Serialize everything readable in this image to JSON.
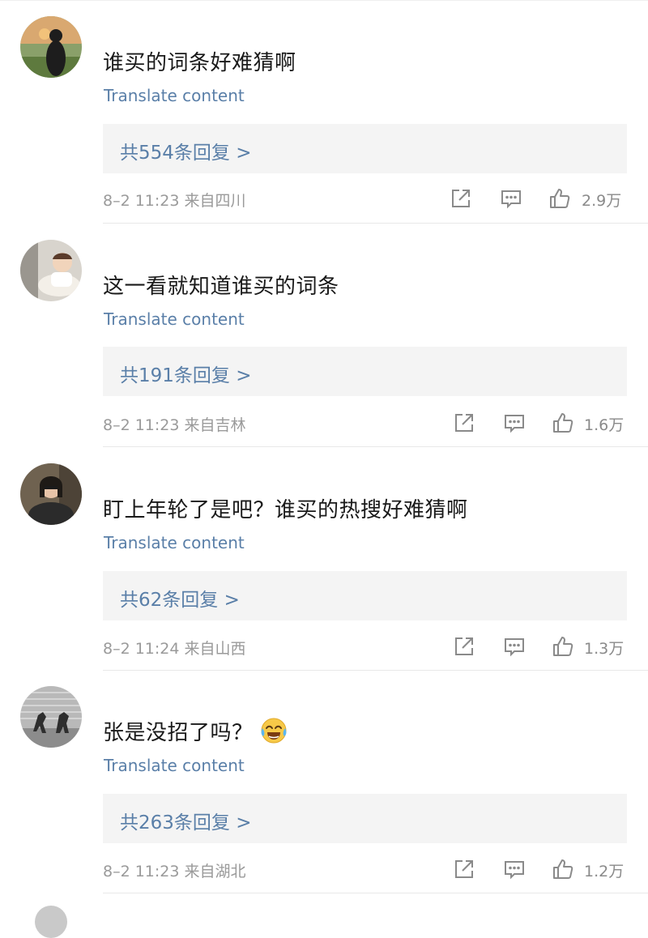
{
  "comments": [
    {
      "text": "谁买的词条好难猜啊",
      "translate": "Translate content",
      "replies": "共554条回复 >",
      "meta": "8–2 11:23 来自四川",
      "likes": "2.9万"
    },
    {
      "text": "这一看就知道谁买的词条",
      "translate": "Translate content",
      "replies": "共191条回复 >",
      "meta": "8–2 11:23 来自吉林",
      "likes": "1.6万"
    },
    {
      "text": "盯上年轮了是吧？谁买的热搜好难猜啊",
      "translate": "Translate content",
      "replies": "共62条回复 >",
      "meta": "8–2 11:24 来自山西",
      "likes": "1.3万"
    },
    {
      "text": "张是没招了吗？",
      "translate": "Translate content",
      "replies": "共263条回复 >",
      "meta": "8–2 11:23 来自湖北",
      "likes": "1.2万"
    }
  ],
  "icons": {
    "share": "share-icon",
    "comment": "comment-icon",
    "like": "like-icon",
    "emoji": "laughing-tears-emoji"
  },
  "colors": {
    "link": "#5a7fa8",
    "meta": "#9a9a9a",
    "reply_bg": "#f4f4f4"
  }
}
